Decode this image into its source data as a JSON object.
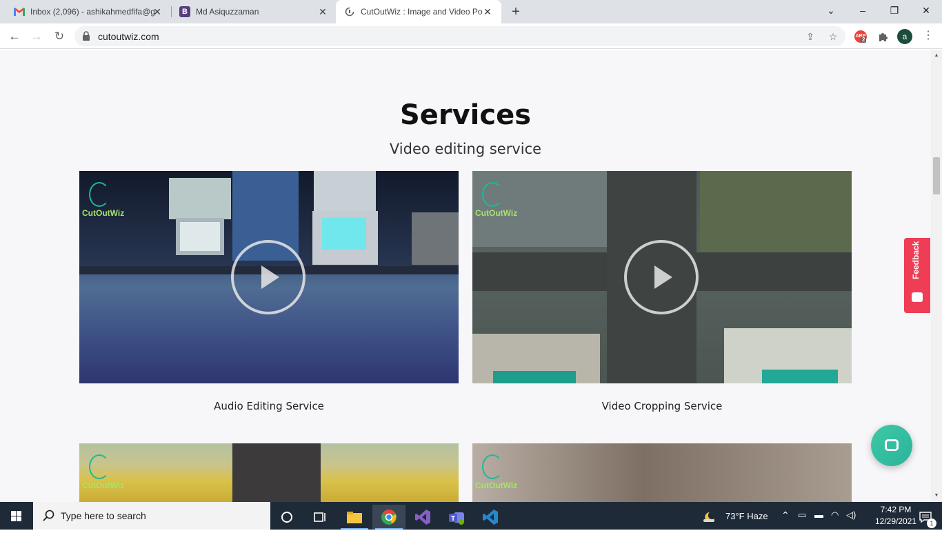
{
  "browser": {
    "tabs": [
      {
        "title": "Inbox (2,096) - ashikahmedfifa@g",
        "favicon": "gmail-icon"
      },
      {
        "title": "Md Asiquzzaman",
        "favicon": "B"
      },
      {
        "title": "CutOutWiz : Image and Video Po",
        "favicon": "cutoutwiz-icon"
      }
    ],
    "url": "cutoutwiz.com",
    "ext_badge": "ABP",
    "ext_count": "2",
    "avatar_letter": "a"
  },
  "page": {
    "heading": "Services",
    "subheading": "Video editing service",
    "brand_text": "CutOutWiz",
    "cards": [
      {
        "caption": "Audio Editing Service"
      },
      {
        "caption": "Video Cropping Service"
      }
    ],
    "feedback_label": "Feedback"
  },
  "taskbar": {
    "search_placeholder": "Type here to search",
    "weather": "73°F  Haze",
    "time": "7:42 PM",
    "date": "12/29/2021",
    "notification_count": "1"
  },
  "colors": {
    "accent_red": "#ee3d55",
    "chat_teal": "#3ec9a7",
    "taskbar": "#1f2a38"
  }
}
